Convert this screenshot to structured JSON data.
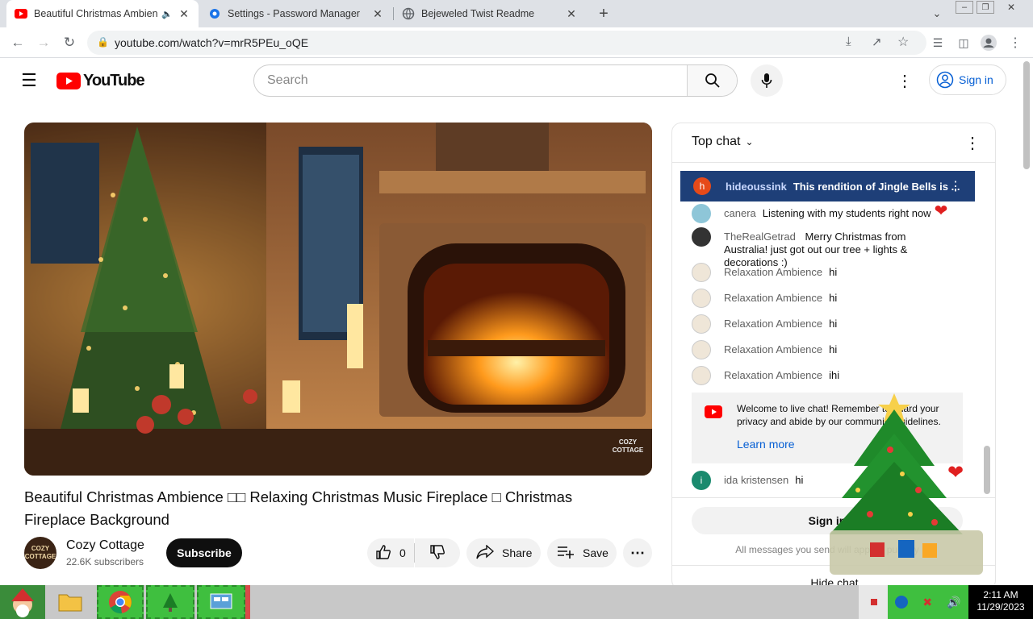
{
  "browser": {
    "tabs": [
      {
        "title": "Beautiful Christmas Ambience",
        "icon": "youtube-icon",
        "audio": true
      },
      {
        "title": "Settings - Password Manager",
        "icon": "gear-icon"
      },
      {
        "title": "Bejeweled Twist Readme",
        "icon": "globe-icon"
      }
    ],
    "url": "youtube.com/watch?v=mrR5PEu_oQE"
  },
  "youtube": {
    "logo_text": "YouTube",
    "search_placeholder": "Search",
    "sign_in": "Sign in"
  },
  "video": {
    "title": "Beautiful Christmas Ambience □□ Relaxing Christmas Music Fireplace □ Christmas Fireplace Background",
    "watermark": "COZY COTTAGE",
    "channel_name": "Cozy Cottage",
    "channel_avatar_text": "COZY COTTAGE",
    "subscribers": "22.6K subscribers",
    "subscribe_label": "Subscribe",
    "likes": "0",
    "share_label": "Share",
    "save_label": "Save"
  },
  "chat": {
    "header": "Top chat",
    "pinned": {
      "author": "hideoussink",
      "text": "This rendition of Jingle Bells is ...",
      "initial": "h"
    },
    "messages": [
      {
        "author": "canera",
        "text": "Listening with my students right now"
      },
      {
        "author": "TheRealGetrad",
        "text": "Merry Christmas from Australia! just got out our tree + lights & decorations :)"
      },
      {
        "author": "Relaxation Ambience",
        "text": "hi"
      },
      {
        "author": "Relaxation Ambience",
        "text": "hi"
      },
      {
        "author": "Relaxation Ambience",
        "text": "hi"
      },
      {
        "author": "Relaxation Ambience",
        "text": "hi"
      },
      {
        "author": "Relaxation Ambience",
        "text": "ihi"
      }
    ],
    "welcome_text": "Welcome to live chat! Remember to guard your privacy and abide by our community guidelines.",
    "learn_more": "Learn more",
    "last_message": {
      "author": "ida kristensen",
      "text": "hi",
      "initial": "i"
    },
    "sign_in_label": "Sign in",
    "all_messages_note": "All messages you send will appear publicly",
    "hide_chat": "Hide chat"
  },
  "taskbar": {
    "time": "2:11 AM",
    "date": "11/29/2023"
  },
  "colors": {
    "youtube_red": "#ff0000",
    "link_blue": "#065fd4",
    "pinned_bg": "#1e3f78",
    "taskbar_green": "#3fbf3f"
  }
}
